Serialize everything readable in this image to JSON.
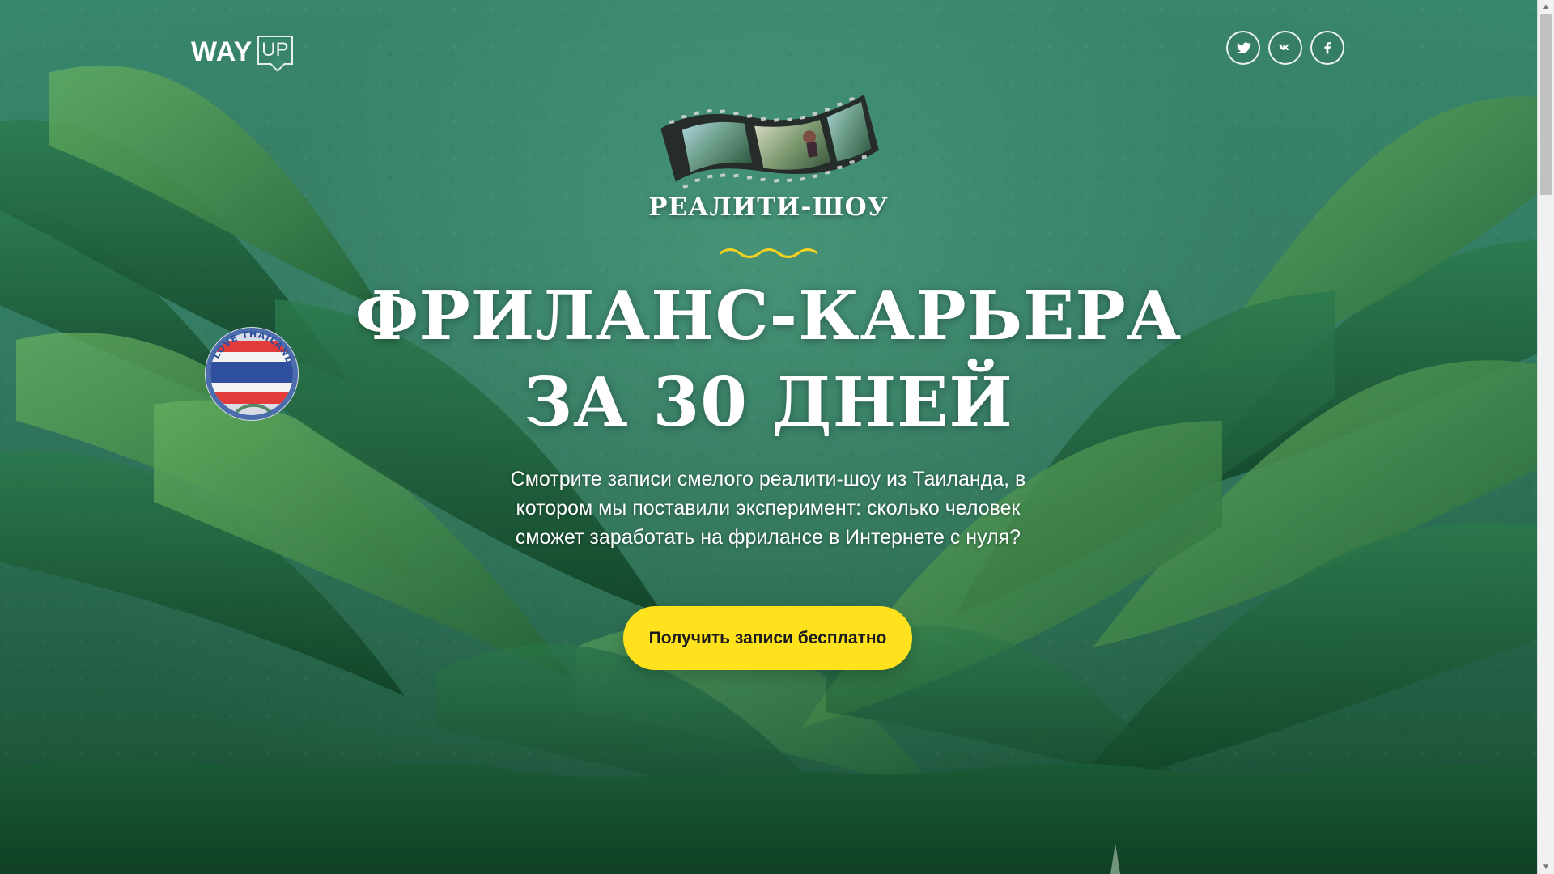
{
  "header": {
    "logo_primary": "WAY",
    "logo_secondary": "UP",
    "social_links": [
      {
        "label": "Twitter",
        "icon": "twitter-icon"
      },
      {
        "label": "VK",
        "icon": "vk-icon"
      },
      {
        "label": "Facebook",
        "icon": "facebook-icon"
      }
    ]
  },
  "hero": {
    "eyebrow": "РЕАЛИТИ-ШОУ",
    "headline_line_1": "ФРИЛАНС-КАРЬЕРА",
    "headline_line_2": "ЗА 30 ДНЕЙ",
    "description": "Смотрите записи смелого реалити-шоу из Таиланда, в котором мы поставили эксперимент: сколько человек сможет заработать на фрилансе в Интернете с нуля?",
    "cta_label": "Получить записи бесплатно",
    "stamp_text": "I LOVE THAILAND"
  },
  "colors": {
    "background": "#2f7b63",
    "accent": "#ffe11d",
    "text": "#ffffff"
  }
}
